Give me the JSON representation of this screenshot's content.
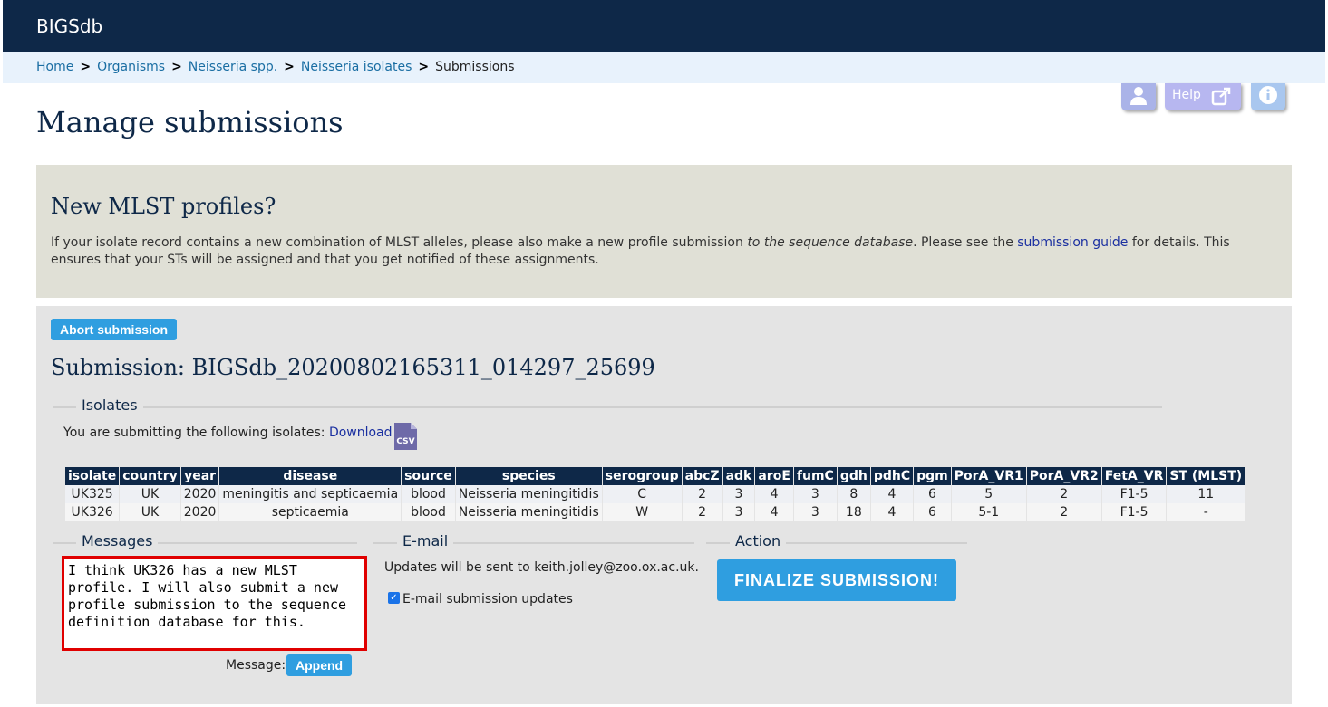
{
  "app": {
    "brand": "BIGSdb"
  },
  "breadcrumb": {
    "items": [
      "Home",
      "Organisms",
      "Neisseria spp.",
      "Neisseria isolates"
    ],
    "current": "Submissions"
  },
  "tools": {
    "help_label": "Help"
  },
  "page": {
    "title": "Manage submissions"
  },
  "notice": {
    "heading": "New MLST profiles?",
    "text_1": "If your isolate record contains a new combination of MLST alleles, please also make a new profile submission ",
    "text_em": "to the sequence database",
    "text_2": ". Please see the ",
    "link": "submission guide",
    "text_3": " for details. This ensures that your STs will be assigned and that you get notified of these assignments."
  },
  "submission": {
    "abort_label": "Abort submission",
    "title": "Submission: BIGSdb_20200802165311_014297_25699",
    "isolates_legend": "Isolates",
    "isolates_intro": "You are submitting the following isolates: ",
    "download_label": "Download",
    "csv_label": "CSV"
  },
  "table": {
    "headers": [
      "isolate",
      "country",
      "year",
      "disease",
      "source",
      "species",
      "serogroup",
      "abcZ",
      "adk",
      "aroE",
      "fumC",
      "gdh",
      "pdhC",
      "pgm",
      "PorA_VR1",
      "PorA_VR2",
      "FetA_VR",
      "ST (MLST)"
    ],
    "rows": [
      [
        "UK325",
        "UK",
        "2020",
        "meningitis and septicaemia",
        "blood",
        "Neisseria meningitidis",
        "C",
        "2",
        "3",
        "4",
        "3",
        "8",
        "4",
        "6",
        "5",
        "2",
        "F1-5",
        "11"
      ],
      [
        "UK326",
        "UK",
        "2020",
        "septicaemia",
        "blood",
        "Neisseria meningitidis",
        "W",
        "2",
        "3",
        "4",
        "3",
        "18",
        "4",
        "6",
        "5-1",
        "2",
        "F1-5",
        "-"
      ]
    ]
  },
  "messages": {
    "legend": "Messages",
    "value": "I think UK326 has a new MLST profile. I will also submit a new profile submission to the sequence definition database for this.",
    "label": "Message:",
    "append_label": "Append"
  },
  "email": {
    "legend": "E-mail",
    "text": "Updates will be sent to keith.jolley@zoo.ox.ac.uk.",
    "checkbox_label": "E-mail submission updates",
    "checked": true
  },
  "action": {
    "legend": "Action",
    "finalize_label": "FINALIZE SUBMISSION!"
  },
  "colors": {
    "header_bg": "#0e2848",
    "breadcrumb_bg": "#e8f2fc",
    "button": "#2f9ee0",
    "notice_bg": "#e0e0d6",
    "panel_bg": "#e4e4e4",
    "highlight_border": "#e00000"
  }
}
